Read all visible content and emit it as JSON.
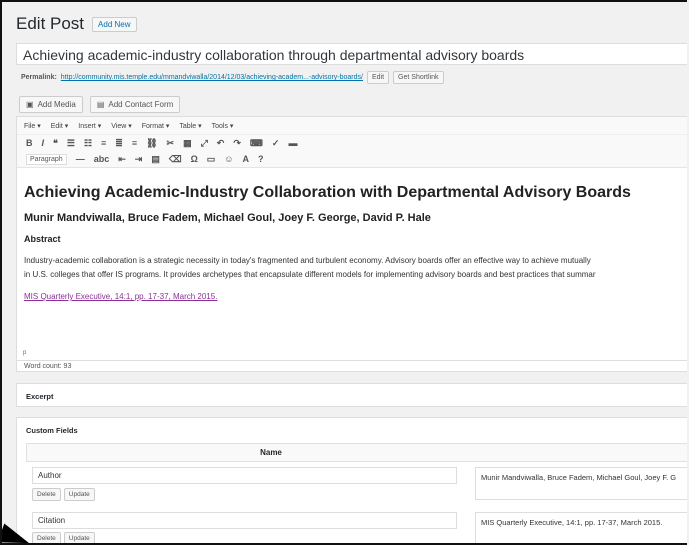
{
  "header": {
    "title": "Edit Post",
    "add_new": "Add New"
  },
  "post_title": "Achieving academic-industry collaboration through departmental advisory boards",
  "permalink": {
    "label": "Permalink:",
    "url": "http://community.mis.temple.edu/mmandviwalla/2014/12/03/achieving-academ...-advisory-boards/",
    "edit": "Edit",
    "shortlink": "Get Shortlink"
  },
  "media": {
    "add_media": "Add Media",
    "add_form": "Add Contact Form"
  },
  "menubar": [
    "File ▾",
    "Edit ▾",
    "Insert ▾",
    "View ▾",
    "Format ▾",
    "Table ▾",
    "Tools ▾"
  ],
  "toolbar": {
    "format": "Paragraph"
  },
  "content": {
    "title": "Achieving Academic-Industry Collaboration with Departmental Advisory Boards",
    "authors": "Munir Mandviwalla, Bruce Fadem, Michael Goul, Joey F. George, David P. Hale",
    "abstract_heading": "Abstract",
    "para1": "Industry-academic collaboration is a strategic necessity in today's fragmented and turbulent economy. Advisory boards offer an effective way to achieve mutually",
    "para2": "in U.S. colleges that offer IS programs. It provides archetypes that encapsulate different models for implementing advisory boards and best practices that summar",
    "citation_link": "MIS Quarterly Executive, 14:1, pp. 17-37, March 2015."
  },
  "status": {
    "path": "p",
    "word_count": "Word count: 93"
  },
  "excerpt": {
    "title": "Excerpt"
  },
  "custom_fields": {
    "title": "Custom Fields",
    "name_header": "Name",
    "rows": [
      {
        "name": "Author",
        "value": "Munir Mandviwalla, Bruce Fadem, Michael Goul, Joey F. G"
      },
      {
        "name": "Citation",
        "value": "MIS Quarterly Executive, 14:1, pp. 17-37, March 2015."
      }
    ],
    "delete": "Delete",
    "update": "Update"
  }
}
